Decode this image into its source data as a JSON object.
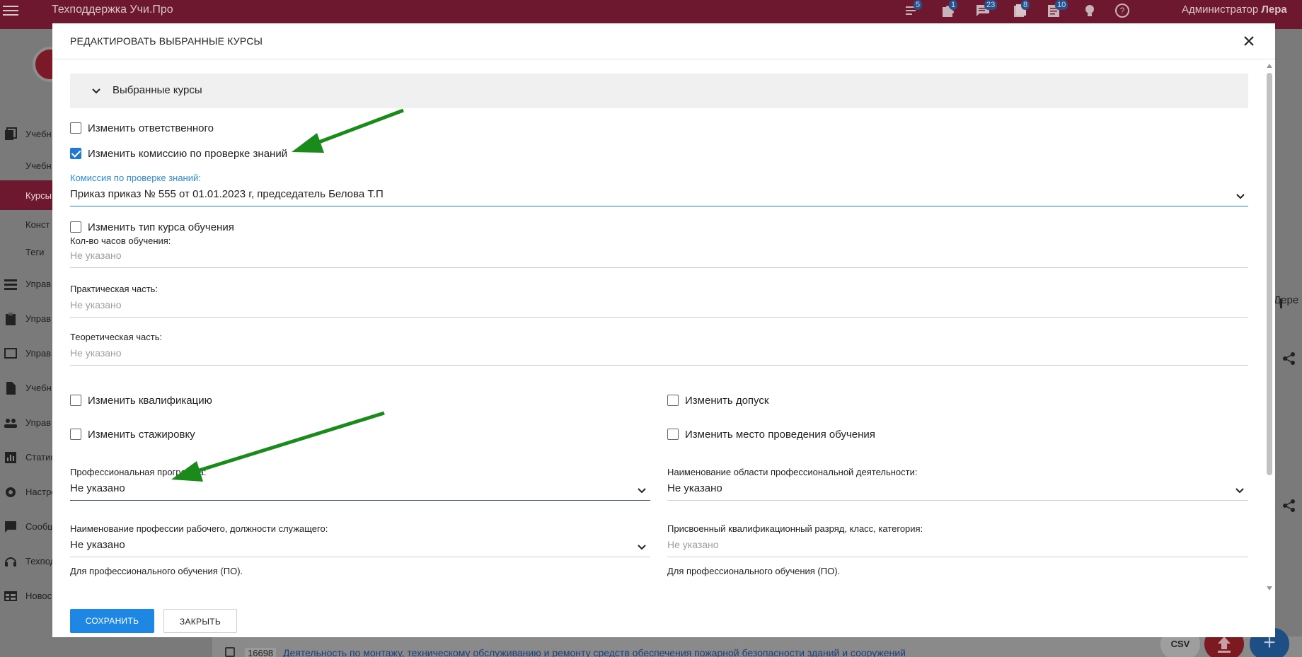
{
  "app": {
    "title": "Техподдержка Учи.Про",
    "user_role": "Администратор",
    "user_name": "Лера",
    "badges": [
      "5",
      "1",
      "23",
      "8",
      "10"
    ]
  },
  "sidebar": {
    "items": [
      "Учебн",
      "Управ",
      "Управ",
      "Управ",
      "Учебн",
      "Управ",
      "Статис",
      "Настро",
      "Сообщ",
      "Техпод",
      "Новост"
    ],
    "subitems": [
      "Учебн",
      "Курсы",
      "Конст",
      "Теги"
    ],
    "active": "Курсы"
  },
  "background": {
    "right_text": "Дере",
    "row_id": "16698",
    "row_title": "Деятельность по монтажу, техническому обслуживанию и ремонту средств обеспечения пожарной безопасности зданий и сооружений",
    "csv_label": "CSV",
    "add_label": "+"
  },
  "modal": {
    "title": "РЕДАКТИРОВАТЬ ВЫБРАННЫЕ КУРСЫ",
    "accordion_label": "Выбранные курсы",
    "change_responsible": "Изменить ответственного",
    "change_commission": "Изменить комиссию по проверке знаний",
    "commission_label": "Комиссия по проверке знаний:",
    "commission_value": "Приказ приказ № 555 от 01.01.2023 г, председатель Белова Т.П",
    "change_course_type": "Изменить тип курса обучения",
    "hours_label": "Кол-во часов обучения:",
    "practical_label": "Практическая часть:",
    "theoretical_label": "Теоретическая часть:",
    "not_specified": "Не указано",
    "change_qualification": "Изменить квалификацию",
    "change_admission": "Изменить допуск",
    "change_internship": "Изменить стажировку",
    "change_location": "Изменить место проведения обучения",
    "prof_program_label": "Профессиональная программа:",
    "prof_area_label": "Наименование области профессиональной деятельности:",
    "profession_label": "Наименование профессии рабочего, должности служащего:",
    "rank_label": "Присвоенный квалификационный разряд, класс, категория:",
    "po_note": "Для профессионального обучения (ПО).",
    "save_label": "СОХРАНИТЬ",
    "close_label": "ЗАКРЫТЬ"
  }
}
